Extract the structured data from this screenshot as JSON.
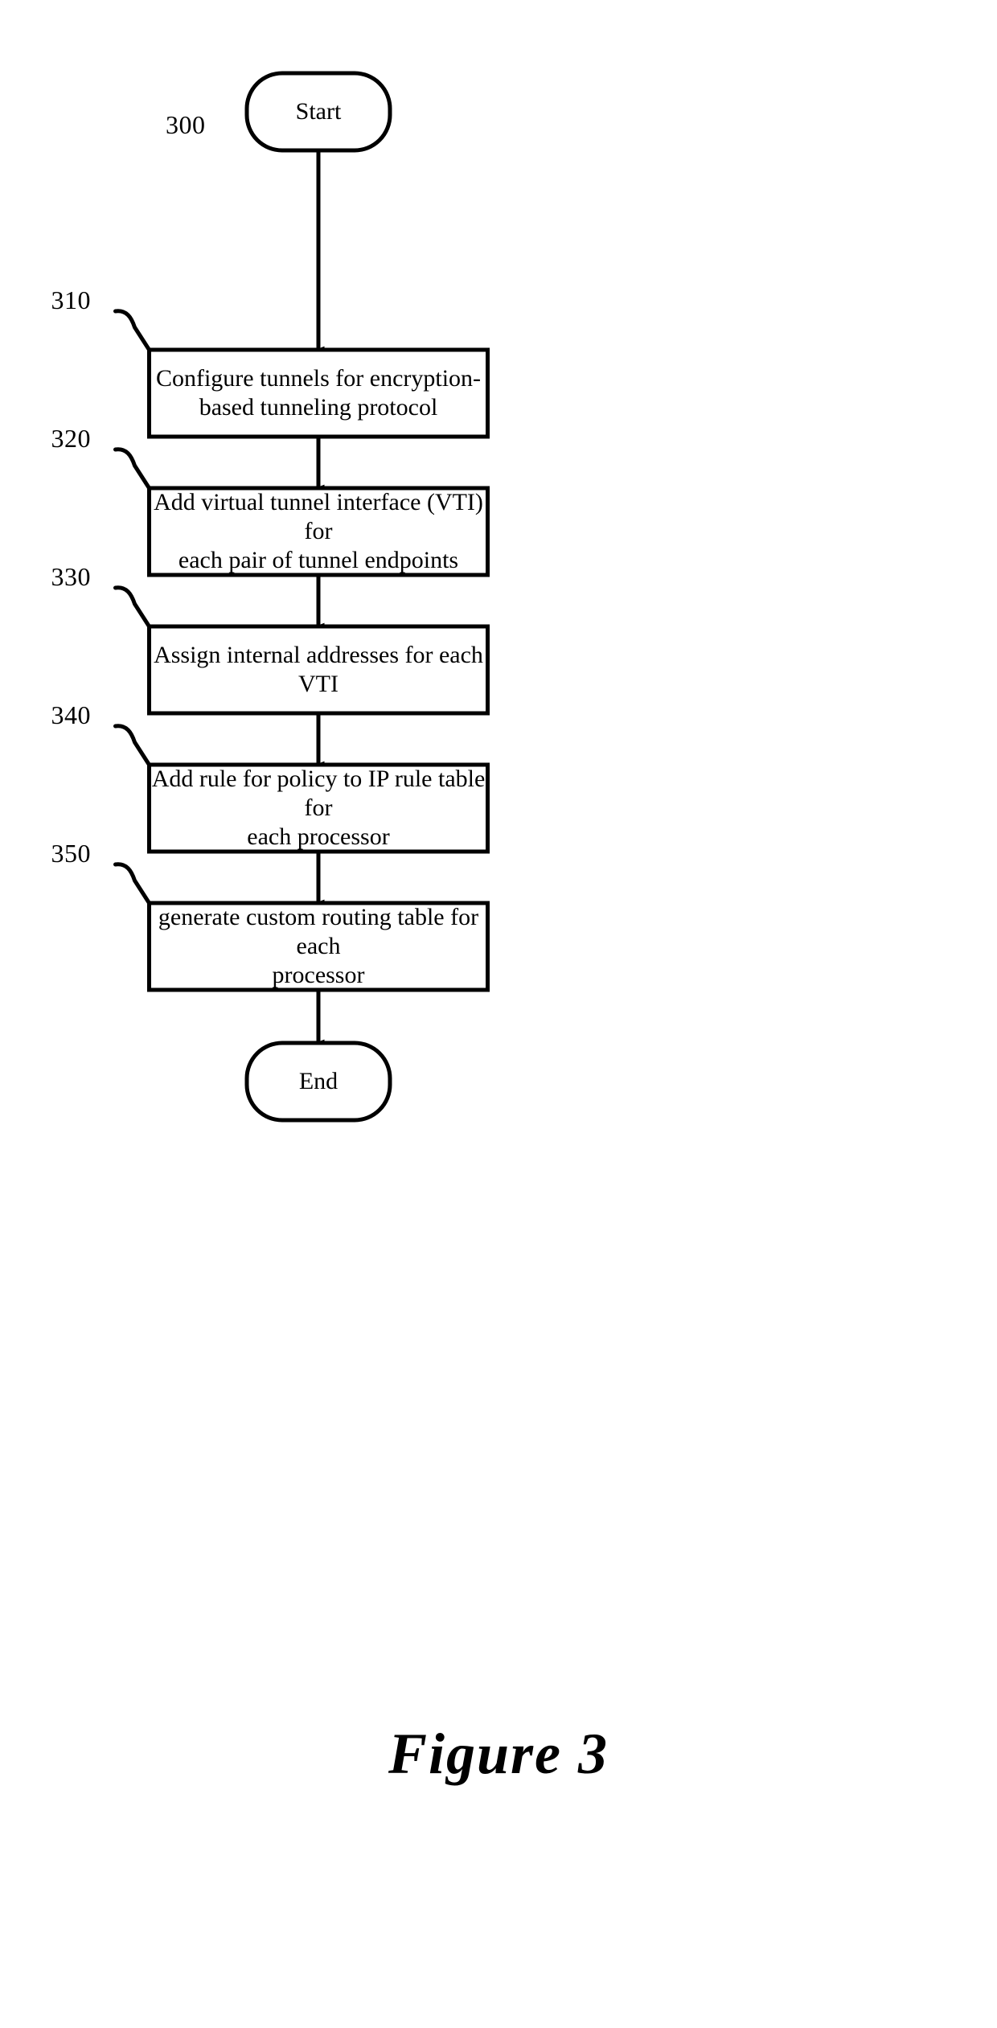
{
  "figure": {
    "caption": "Figure 3",
    "diagram_ref": "300"
  },
  "flowchart": {
    "type": "flowchart",
    "orientation": "vertical",
    "line_color": "#000000",
    "fill_color": "#ffffff",
    "start": {
      "label": "Start",
      "shape": "rounded-terminal"
    },
    "end": {
      "label": "End",
      "shape": "rounded-terminal"
    },
    "steps": [
      {
        "ref": "310",
        "text": "Configure tunnels for encryption-\nbased tunneling protocol",
        "shape": "rectangle"
      },
      {
        "ref": "320",
        "text": "Add virtual tunnel interface (VTI) for\neach pair of tunnel endpoints",
        "shape": "rectangle"
      },
      {
        "ref": "330",
        "text": "Assign internal addresses for each\nVTI",
        "shape": "rectangle"
      },
      {
        "ref": "340",
        "text": "Add rule for policy to IP rule table for\neach processor",
        "shape": "rectangle"
      },
      {
        "ref": "350",
        "text": "generate custom routing table for each\nprocessor",
        "shape": "rectangle"
      }
    ],
    "connectors": [
      {
        "from": "Start",
        "to": "310",
        "arrow": "down"
      },
      {
        "from": "310",
        "to": "320",
        "arrow": "down"
      },
      {
        "from": "320",
        "to": "330",
        "arrow": "down"
      },
      {
        "from": "330",
        "to": "340",
        "arrow": "down"
      },
      {
        "from": "340",
        "to": "350",
        "arrow": "down"
      },
      {
        "from": "350",
        "to": "End",
        "arrow": "down"
      }
    ]
  }
}
